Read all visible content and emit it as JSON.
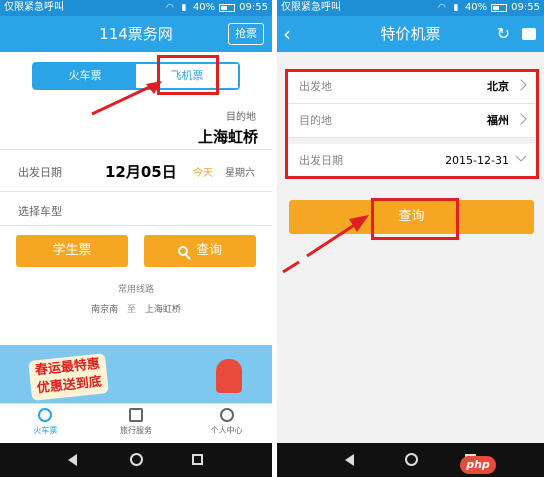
{
  "left": {
    "status": {
      "carrier": "仅限紧急呼叫",
      "battery": "40%",
      "time": "09:55"
    },
    "app_title": "114票务网",
    "grab_ticket_label": "抢票",
    "tabs": [
      {
        "label": "火车票"
      },
      {
        "label": "飞机票"
      }
    ],
    "destination_caption": "目的地",
    "destination_value": "上海虹桥",
    "depart_date_label": "出发日期",
    "depart_date_value": "12月05日",
    "today_label": "今天",
    "weekday_label": "星期六",
    "train_type_label": "选择车型",
    "student_ticket_label": "学生票",
    "search_label": "查询",
    "common_routes_label": "常用线路",
    "route": {
      "from": "南京南",
      "to_word": "至",
      "to": "上海虹桥"
    },
    "banner_text": [
      "春运最特惠",
      "优惠送到底"
    ],
    "bottom_nav": [
      {
        "label": "火车票",
        "icon": "search-icon"
      },
      {
        "label": "旅行服务",
        "icon": "suitcase-icon"
      },
      {
        "label": "个人中心",
        "icon": "user-icon"
      }
    ]
  },
  "right": {
    "status": {
      "carrier": "仅限紧急呼叫",
      "battery": "40%",
      "time": "09:55"
    },
    "page_title": "特价机票",
    "departure_label": "出发地",
    "departure_value": "北京",
    "destination_label": "目的地",
    "destination_value": "福州",
    "date_label": "出发日期",
    "date_value": "2015-12-31",
    "query_label": "查询"
  },
  "watermark": "php",
  "colors": {
    "primary": "#2aa4e6",
    "status_bar": "#1f8fd6",
    "orange": "#f5a623",
    "highlight": "#e02020"
  }
}
